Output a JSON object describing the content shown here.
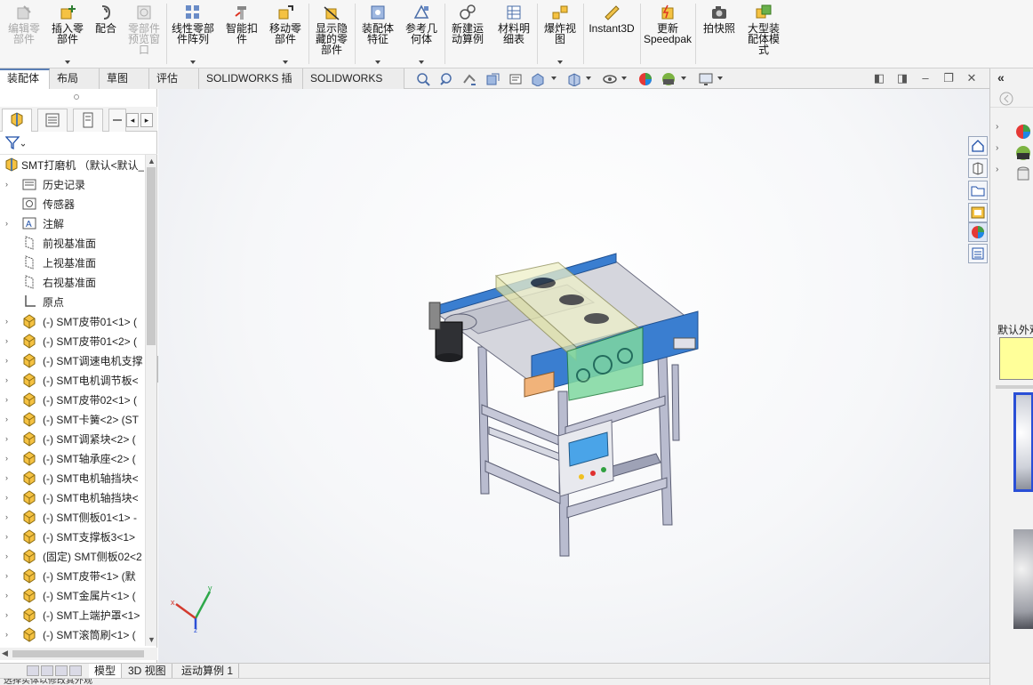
{
  "ribbon": {
    "buttons": [
      {
        "label": "编辑零\n部件",
        "icon": "edit-component-icon",
        "disabled": true
      },
      {
        "label": "插入零\n部件",
        "icon": "insert-component-icon",
        "disabled": false
      },
      {
        "label": "配合",
        "icon": "mate-icon",
        "disabled": false
      },
      {
        "label": "零部件\n预览窗\n口",
        "icon": "component-preview-icon",
        "disabled": true
      },
      {
        "label": "线性零部\n件阵列",
        "icon": "linear-pattern-icon",
        "disabled": false
      },
      {
        "label": "智能扣\n件",
        "icon": "smart-fasteners-icon",
        "disabled": false
      },
      {
        "label": "移动零\n部件",
        "icon": "move-component-icon",
        "disabled": false
      },
      {
        "label": "显示隐\n藏的零\n部件",
        "icon": "show-hidden-icon",
        "disabled": false
      },
      {
        "label": "装配体\n特征",
        "icon": "assembly-features-icon",
        "disabled": false
      },
      {
        "label": "参考几\n何体",
        "icon": "reference-geometry-icon",
        "disabled": false
      },
      {
        "label": "新建运\n动算例",
        "icon": "motion-study-icon",
        "disabled": false
      },
      {
        "label": "材料明\n细表",
        "icon": "bom-icon",
        "disabled": false
      },
      {
        "label": "爆炸视\n图",
        "icon": "exploded-view-icon",
        "disabled": false
      },
      {
        "label": "Instant3D",
        "icon": "instant3d-icon",
        "disabled": false
      },
      {
        "label": "更新\nSpeedpak",
        "icon": "speedpak-icon",
        "disabled": false
      },
      {
        "label": "拍快照",
        "icon": "snapshot-icon",
        "disabled": false
      },
      {
        "label": "大型装\n配体模\n式",
        "icon": "large-assembly-icon",
        "disabled": false
      }
    ]
  },
  "tabs": [
    "装配体",
    "布局",
    "草图",
    "评估",
    "SOLIDWORKS 插件",
    "SOLIDWORKS MBD"
  ],
  "tree": {
    "root": "SMT打磨机 （默认<默认_",
    "items": [
      {
        "label": "历史记录",
        "icon": "history-folder-icon",
        "expand": true
      },
      {
        "label": "传感器",
        "icon": "sensor-icon",
        "expand": false
      },
      {
        "label": "注解",
        "icon": "annotation-icon",
        "expand": true
      },
      {
        "label": "前视基准面",
        "icon": "plane-icon",
        "expand": false
      },
      {
        "label": "上视基准面",
        "icon": "plane-icon",
        "expand": false
      },
      {
        "label": "右视基准面",
        "icon": "plane-icon",
        "expand": false
      },
      {
        "label": "原点",
        "icon": "origin-icon",
        "expand": false
      },
      {
        "label": "(-) SMT皮带01<1> (",
        "icon": "part-icon",
        "expand": true
      },
      {
        "label": "(-) SMT皮带01<2> (",
        "icon": "part-icon",
        "expand": true
      },
      {
        "label": "(-) SMT调速电机支撑",
        "icon": "part-icon",
        "expand": true
      },
      {
        "label": "(-) SMT电机调节板<",
        "icon": "part-icon",
        "expand": true
      },
      {
        "label": "(-) SMT皮带02<1> (",
        "icon": "part-icon",
        "expand": true
      },
      {
        "label": "(-) SMT卡簧<2> (ST",
        "icon": "part-icon",
        "expand": true
      },
      {
        "label": "(-) SMT调紧块<2> (",
        "icon": "part-icon",
        "expand": true
      },
      {
        "label": "(-) SMT轴承座<2> (",
        "icon": "part-icon",
        "expand": true
      },
      {
        "label": "(-) SMT电机轴挡块<",
        "icon": "part-icon",
        "expand": true
      },
      {
        "label": "(-) SMT电机轴挡块<",
        "icon": "part-icon",
        "expand": true
      },
      {
        "label": "(-) SMT侧板01<1> -",
        "icon": "part-icon",
        "expand": true
      },
      {
        "label": "(-) SMT支撑板3<1>",
        "icon": "part-icon",
        "expand": true
      },
      {
        "label": "(固定) SMT侧板02<2",
        "icon": "part-icon",
        "expand": true
      },
      {
        "label": "(-) SMT皮带<1> (默",
        "icon": "part-icon",
        "expand": true
      },
      {
        "label": "(-) SMT金属片<1> (",
        "icon": "part-icon",
        "expand": true
      },
      {
        "label": "(-) SMT上端护罩<1>",
        "icon": "part-icon",
        "expand": true
      },
      {
        "label": "(-) SMT滚筒刷<1> (",
        "icon": "part-icon",
        "expand": true
      }
    ]
  },
  "bottom_tabs": [
    "模型",
    "3D 视图",
    "运动算例 1"
  ],
  "right_panel": {
    "appearance_label": "默认外观"
  },
  "status_text": "选择实体以修改其外观"
}
